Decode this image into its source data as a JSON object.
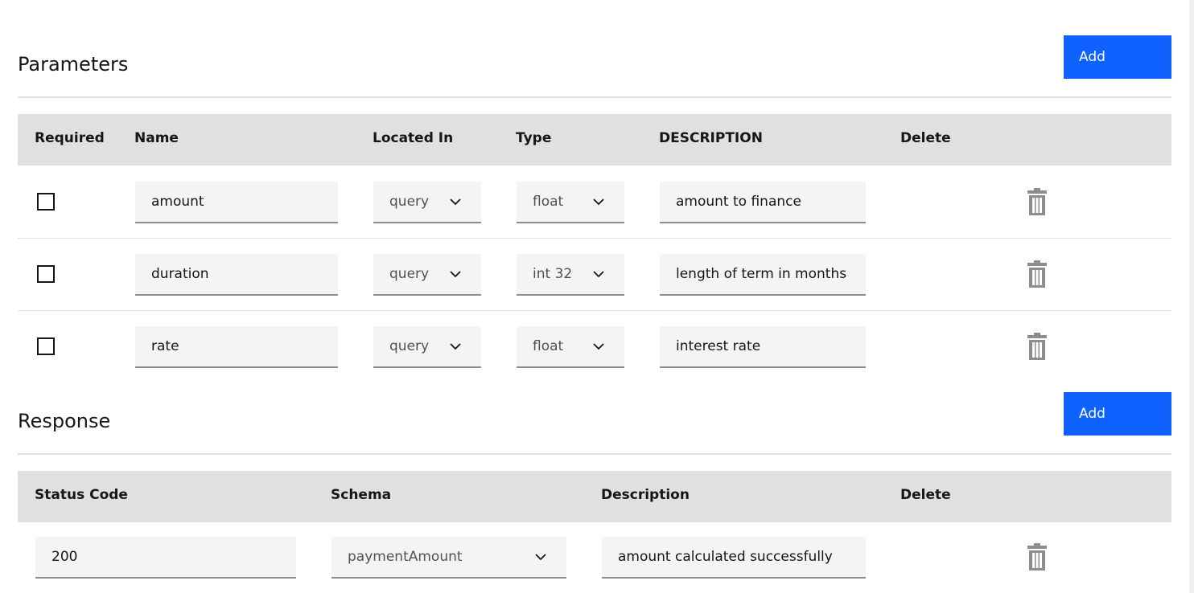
{
  "parameters": {
    "title": "Parameters",
    "add_label": "Add",
    "headers": [
      "Required",
      "Name",
      "Located In",
      "Type",
      "DESCRIPTION",
      "Delete"
    ],
    "rows": [
      {
        "required": false,
        "name": "amount",
        "located_in": "query",
        "type": "float",
        "description": "amount to finance"
      },
      {
        "required": false,
        "name": "duration",
        "located_in": "query",
        "type": "int 32",
        "description": "length of term in months"
      },
      {
        "required": false,
        "name": "rate",
        "located_in": "query",
        "type": "float",
        "description": "interest rate"
      }
    ]
  },
  "response": {
    "title": "Response",
    "add_label": "Add",
    "headers": [
      "Status Code",
      "Schema",
      "Description",
      "Delete"
    ],
    "rows": [
      {
        "status_code": "200",
        "schema": "paymentAmount",
        "description": "amount calculated successfully"
      }
    ]
  },
  "icons": {
    "delete": "trash-icon",
    "dropdown": "chevron-down-icon"
  },
  "colors": {
    "accent": "#0f62fe",
    "header_bg": "#e0e0e0",
    "field_bg": "#f4f4f4",
    "icon": "#8d8d8d"
  }
}
